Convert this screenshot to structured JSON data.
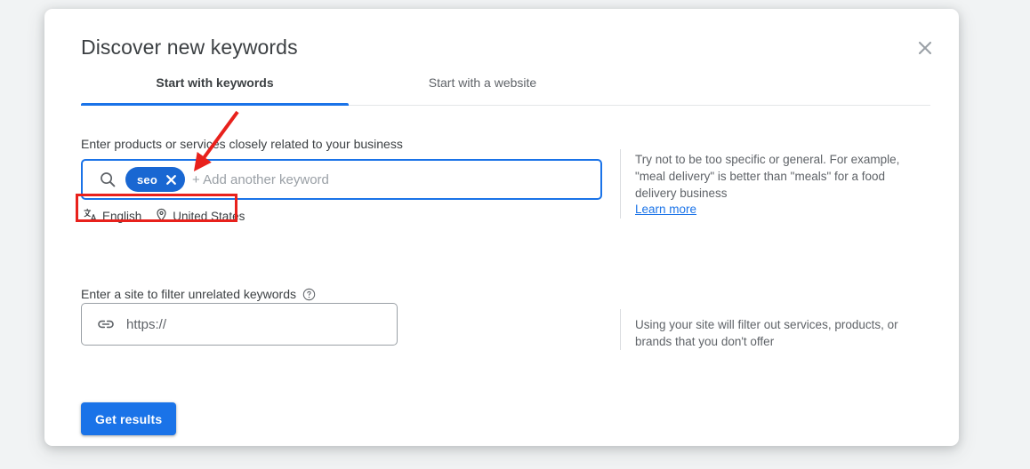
{
  "dialog": {
    "title": "Discover new keywords",
    "close_label": "Close",
    "close_icon": "close-icon"
  },
  "tabs": [
    {
      "label": "Start with keywords",
      "selected": true
    },
    {
      "label": "Start with a website",
      "selected": false
    }
  ],
  "keywords_section": {
    "label": "Enter products or services closely related to your business",
    "search_icon": "search-icon",
    "chips": [
      {
        "text": "seo",
        "remove_icon": "close-icon"
      }
    ],
    "placeholder": "+ Add another keyword",
    "language": {
      "icon": "translate-icon",
      "label": "English"
    },
    "location": {
      "icon": "location-pin-icon",
      "label": "United States"
    },
    "help_text": "Try not to be too specific or general. For example, \"meal delivery\" is better than \"meals\" for a food delivery business",
    "learn_more": "Learn more"
  },
  "site_section": {
    "label": "Enter a site to filter unrelated keywords",
    "help_icon": "help-circle-icon",
    "link_icon": "link-icon",
    "placeholder": "https://",
    "value": "",
    "help_text": "Using your site will filter out services, products, or brands that you don't offer"
  },
  "actions": {
    "get_results": "Get results"
  },
  "colors": {
    "accent_blue": "#1a73e8",
    "chip_blue": "#1967d2",
    "annotation_red": "#e8211c",
    "page_background": "#f1f3f4",
    "text_primary": "#3c4043",
    "text_secondary": "#5f6368"
  }
}
